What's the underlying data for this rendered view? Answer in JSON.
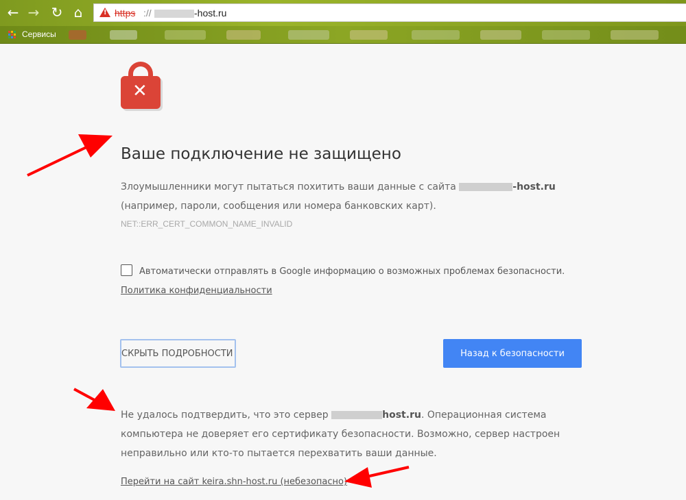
{
  "browser": {
    "url_scheme": "https",
    "url_separator": "://",
    "url_host_visible": "-host.ru",
    "bookmark_label": "Сервисы"
  },
  "page": {
    "heading": "Ваше подключение не защищено",
    "intro_line1": "Злоумышленники могут пытаться похитить ваши данные с сайта",
    "intro_host": "-host.ru",
    "intro_line2": "(например, пароли, сообщения или номера банковских карт).",
    "error_code": "NET::ERR_CERT_COMMON_NAME_INVALID",
    "checkbox_label": "Автоматически отправлять в Google информацию о возможных проблемах безопасности.",
    "privacy_link": "Политика конфиденциальности",
    "hide_details_button": "СКРЫТЬ ПОДРОБНОСТИ",
    "back_button": "Назад к безопасности",
    "details_part1": "Не удалось подтвердить, что это сервер",
    "details_host": "host.ru",
    "details_part2": ". Операционная система",
    "details_line2": "компьютера не доверяет его сертификату безопасности. Возможно, сервер настроен",
    "details_line3": "неправильно или кто-то пытается перехватить ваши данные.",
    "proceed_link": "Перейти на сайт keira.shn-host.ru (небезопасно)"
  },
  "colors": {
    "toolbar": "#9bb42a",
    "lock": "#db4437",
    "primary_button": "#4285f4",
    "annotation_arrow": "#ff0000"
  }
}
